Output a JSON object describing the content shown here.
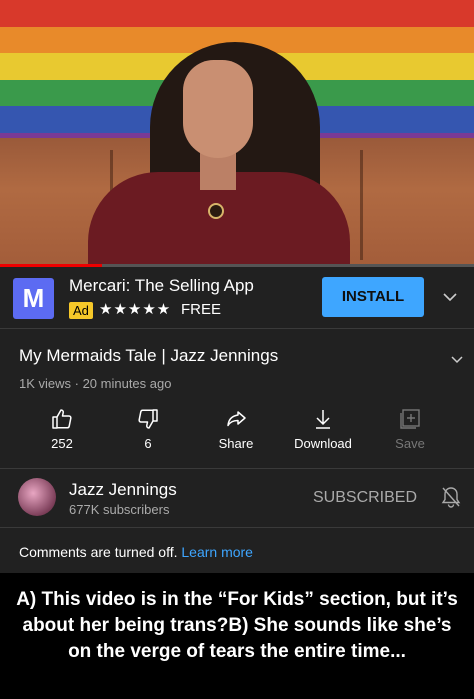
{
  "video": {
    "flag_colors": [
      "#d8392b",
      "#e88a2a",
      "#e8c930",
      "#3a9a4b",
      "#3556b0",
      "#7a3a96"
    ],
    "progress_percent": 21.5
  },
  "ad": {
    "logo_letter": "M",
    "title": "Mercari: The Selling App",
    "badge": "Ad",
    "stars": "★★★★★",
    "price": "FREE",
    "install_label": "INSTALL",
    "accent_color": "#3ea6ff"
  },
  "video_info": {
    "title": "My Mermaids Tale | Jazz Jennings",
    "meta": "1K views · 20 minutes ago"
  },
  "actions": [
    {
      "icon": "thumbs-up-icon",
      "label": "252"
    },
    {
      "icon": "thumbs-down-icon",
      "label": "6"
    },
    {
      "icon": "share-icon",
      "label": "Share"
    },
    {
      "icon": "download-icon",
      "label": "Download"
    },
    {
      "icon": "save-icon",
      "label": "Save"
    }
  ],
  "channel": {
    "name": "Jazz Jennings",
    "subscribers": "677K subscribers",
    "subscribe_state": "SUBSCRIBED"
  },
  "comments": {
    "text": "Comments are turned off.",
    "link": "Learn more"
  },
  "caption": "A) This video is in the “For Kids” section, but it’s about her being trans?B) She sounds like she’s on the verge of tears the entire time..."
}
